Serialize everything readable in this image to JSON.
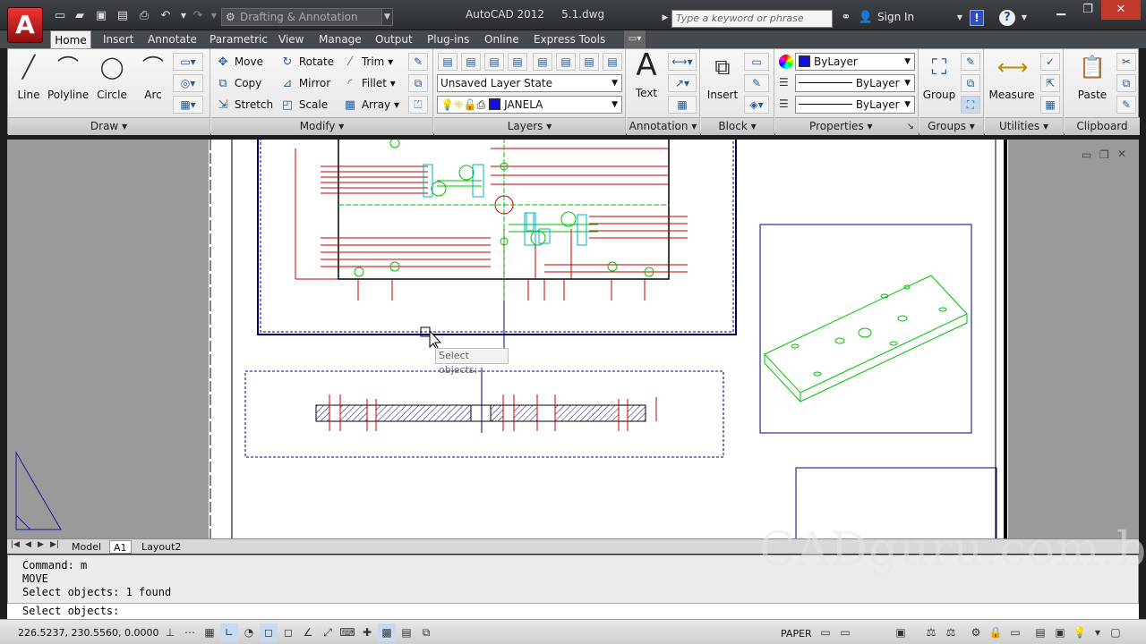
{
  "title_bar": {
    "app_title": "AutoCAD 2012     5.1.dwg",
    "workspace": "Drafting & Annotation",
    "search_placeholder": "Type a keyword or phrase",
    "sign_in": "Sign In",
    "help": "?"
  },
  "tabs": [
    "Home",
    "Insert",
    "Annotate",
    "Parametric",
    "View",
    "Manage",
    "Output",
    "Plug-ins",
    "Online",
    "Express Tools"
  ],
  "panels": {
    "draw": {
      "title": "Draw",
      "line": "Line",
      "polyline": "Polyline",
      "circle": "Circle",
      "arc": "Arc"
    },
    "modify": {
      "title": "Modify",
      "move": "Move",
      "rotate": "Rotate",
      "trim": "Trim",
      "copy": "Copy",
      "mirror": "Mirror",
      "fillet": "Fillet",
      "stretch": "Stretch",
      "scale": "Scale",
      "array": "Array"
    },
    "layers": {
      "title": "Layers",
      "layer_state": "Unsaved Layer State",
      "current_layer": "JANELA"
    },
    "annotation": {
      "title": "Annotation",
      "text": "Text"
    },
    "block": {
      "title": "Block",
      "insert": "Insert"
    },
    "properties": {
      "title": "Properties",
      "color": "ByLayer",
      "linetype": "ByLayer",
      "lineweight": "ByLayer"
    },
    "groups": {
      "title": "Groups",
      "group": "Group"
    },
    "utilities": {
      "title": "Utilities",
      "measure": "Measure"
    },
    "clipboard": {
      "title": "Clipboard",
      "paste": "Paste"
    }
  },
  "drawing": {
    "tooltip": "Select objects:"
  },
  "layout_tabs": [
    "Model",
    "A1",
    "Layout2"
  ],
  "command": {
    "lines": [
      "Command: m",
      "MOVE",
      "Select objects: 1 found"
    ],
    "prompt": "Select objects:"
  },
  "status": {
    "coords": "226.5237, 230.5560, 0.0000",
    "space": "PAPER"
  },
  "watermark": "CADguru.com.br",
  "colors": {
    "accent": "#1010e0",
    "title_bar": "#2b2e31"
  }
}
